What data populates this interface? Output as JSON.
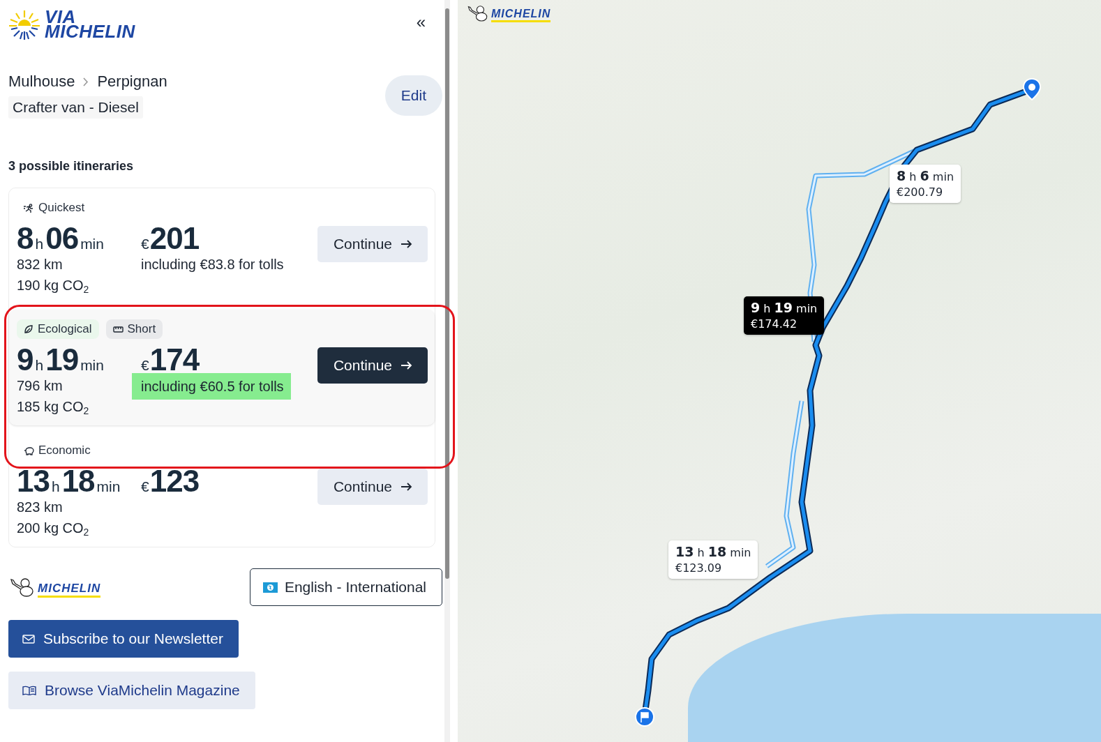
{
  "sidebar": {
    "logo": {
      "line_1": "VIA",
      "line_2": "MICHELIN"
    },
    "collapse_label": "«",
    "route": {
      "from": "Mulhouse",
      "to": "Perpignan",
      "vehicle": "Crafter van - Diesel",
      "edit_label": "Edit"
    },
    "itineraries_heading": "3 possible itineraries",
    "itineraries": [
      {
        "tags": [
          {
            "kind": "quickest",
            "label": "Quickest"
          }
        ],
        "hours": "8",
        "hour_unit": "h",
        "minutes": "06",
        "minute_unit": "min",
        "distance": "832 km",
        "co2": "190 kg CO$_{2}$",
        "currency": "€",
        "price": "201",
        "tolls": "including €83.8 for tolls",
        "selected": false,
        "button": "Continue"
      },
      {
        "tags": [
          {
            "kind": "ecological",
            "label": "Ecological"
          },
          {
            "kind": "short",
            "label": "Short"
          }
        ],
        "hours": "9",
        "hour_unit": "h",
        "minutes": "19",
        "minute_unit": "min",
        "distance": "796 km",
        "co2": "185 kg CO$_{2}$",
        "currency": "€",
        "price": "174",
        "tolls": "including €60.5 for tolls",
        "tolls_highlighted": true,
        "selected": true,
        "outlined": true,
        "button": "Continue"
      },
      {
        "tags": [
          {
            "kind": "economic",
            "label": "Economic"
          }
        ],
        "hours": "13",
        "hour_unit": "h",
        "minutes": "18",
        "minute_unit": "min",
        "distance": "823 km",
        "co2": "200 kg CO$_{2}$",
        "currency": "€",
        "price": "123",
        "selected": false,
        "button": "Continue"
      }
    ],
    "footer": {
      "brand": "MICHELIN",
      "language": "English - International",
      "newsletter": "Subscribe to our Newsletter",
      "magazine": "Browse ViaMichelin Magazine"
    }
  },
  "map": {
    "logo": "MICHELIN",
    "callouts": [
      {
        "duration": "**8** h **6** min",
        "price": "€200.79",
        "selected": false
      },
      {
        "duration": "**9** h **19** min",
        "price": "€174.42",
        "selected": true
      },
      {
        "duration": "**13** h **18** min",
        "price": "€123.09",
        "selected": false
      }
    ]
  }
}
